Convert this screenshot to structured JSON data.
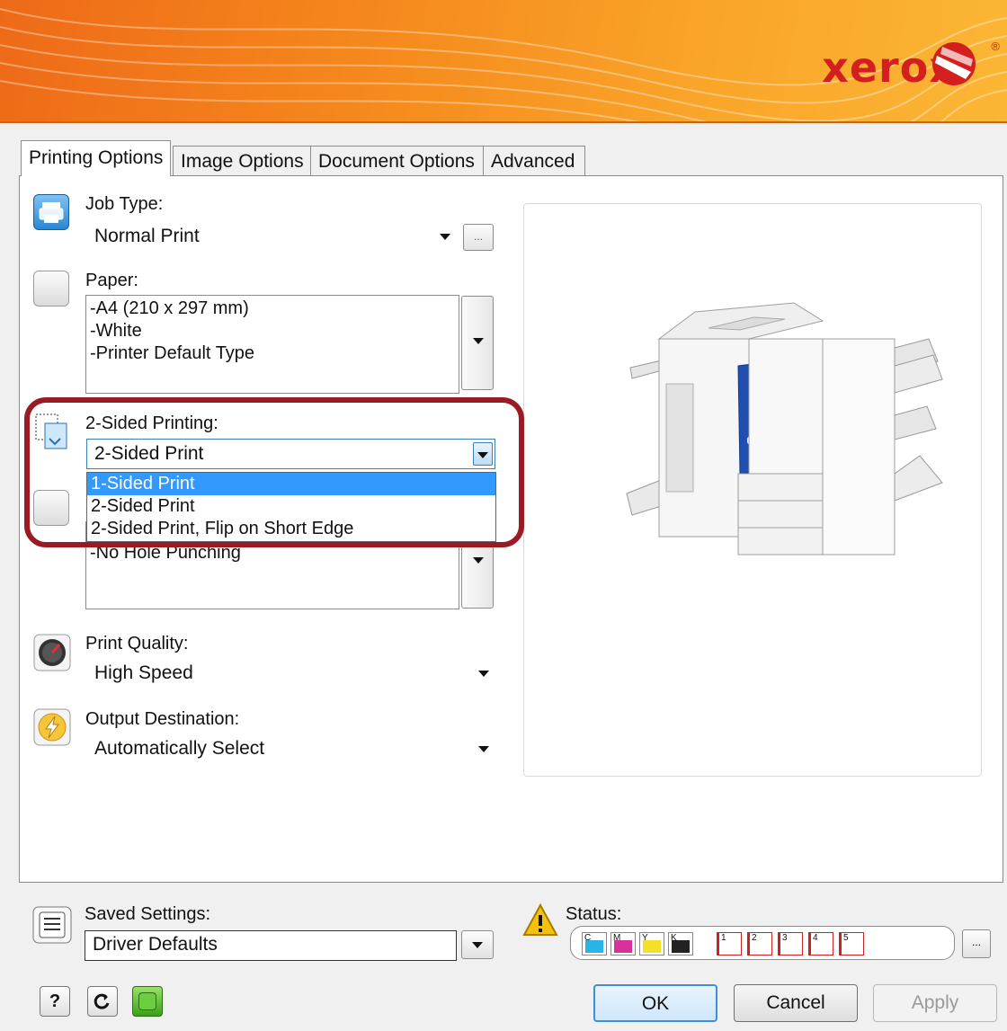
{
  "brand": {
    "name": "xerox",
    "reg": "®"
  },
  "tabs": [
    {
      "label": "Printing Options",
      "active": true
    },
    {
      "label": "Image Options",
      "active": false
    },
    {
      "label": "Document Options",
      "active": false
    },
    {
      "label": "Advanced",
      "active": false
    }
  ],
  "job_type": {
    "label": "Job Type:",
    "value": "Normal Print",
    "more_label": "..."
  },
  "paper": {
    "label": "Paper:",
    "lines": [
      "-A4 (210 x 297 mm)",
      "-White",
      "-Printer Default Type"
    ]
  },
  "two_sided": {
    "label": "2-Sided Printing:",
    "value": "2-Sided Print",
    "options": [
      "1-Sided Print",
      "2-Sided Print",
      "2-Sided Print, Flip on Short Edge"
    ],
    "highlighted_option": "1-Sided Print"
  },
  "finishing": {
    "partial_text": "-No Hole Punching"
  },
  "print_quality": {
    "label": "Print Quality:",
    "value": "High Speed"
  },
  "output_destination": {
    "label": "Output Destination:",
    "value": "Automatically Select"
  },
  "saved_settings": {
    "label": "Saved Settings:",
    "value": "Driver Defaults"
  },
  "status": {
    "label": "Status:",
    "inks": [
      {
        "label": "C",
        "color": "#2bb3e8"
      },
      {
        "label": "M",
        "color": "#d8329a"
      },
      {
        "label": "Y",
        "color": "#f4e02a"
      },
      {
        "label": "K",
        "color": "#222222"
      }
    ],
    "trays": [
      "1",
      "2",
      "3",
      "4",
      "5"
    ],
    "more_label": "..."
  },
  "buttons": {
    "help": "?",
    "ok": "OK",
    "cancel": "Cancel",
    "apply": "Apply"
  }
}
